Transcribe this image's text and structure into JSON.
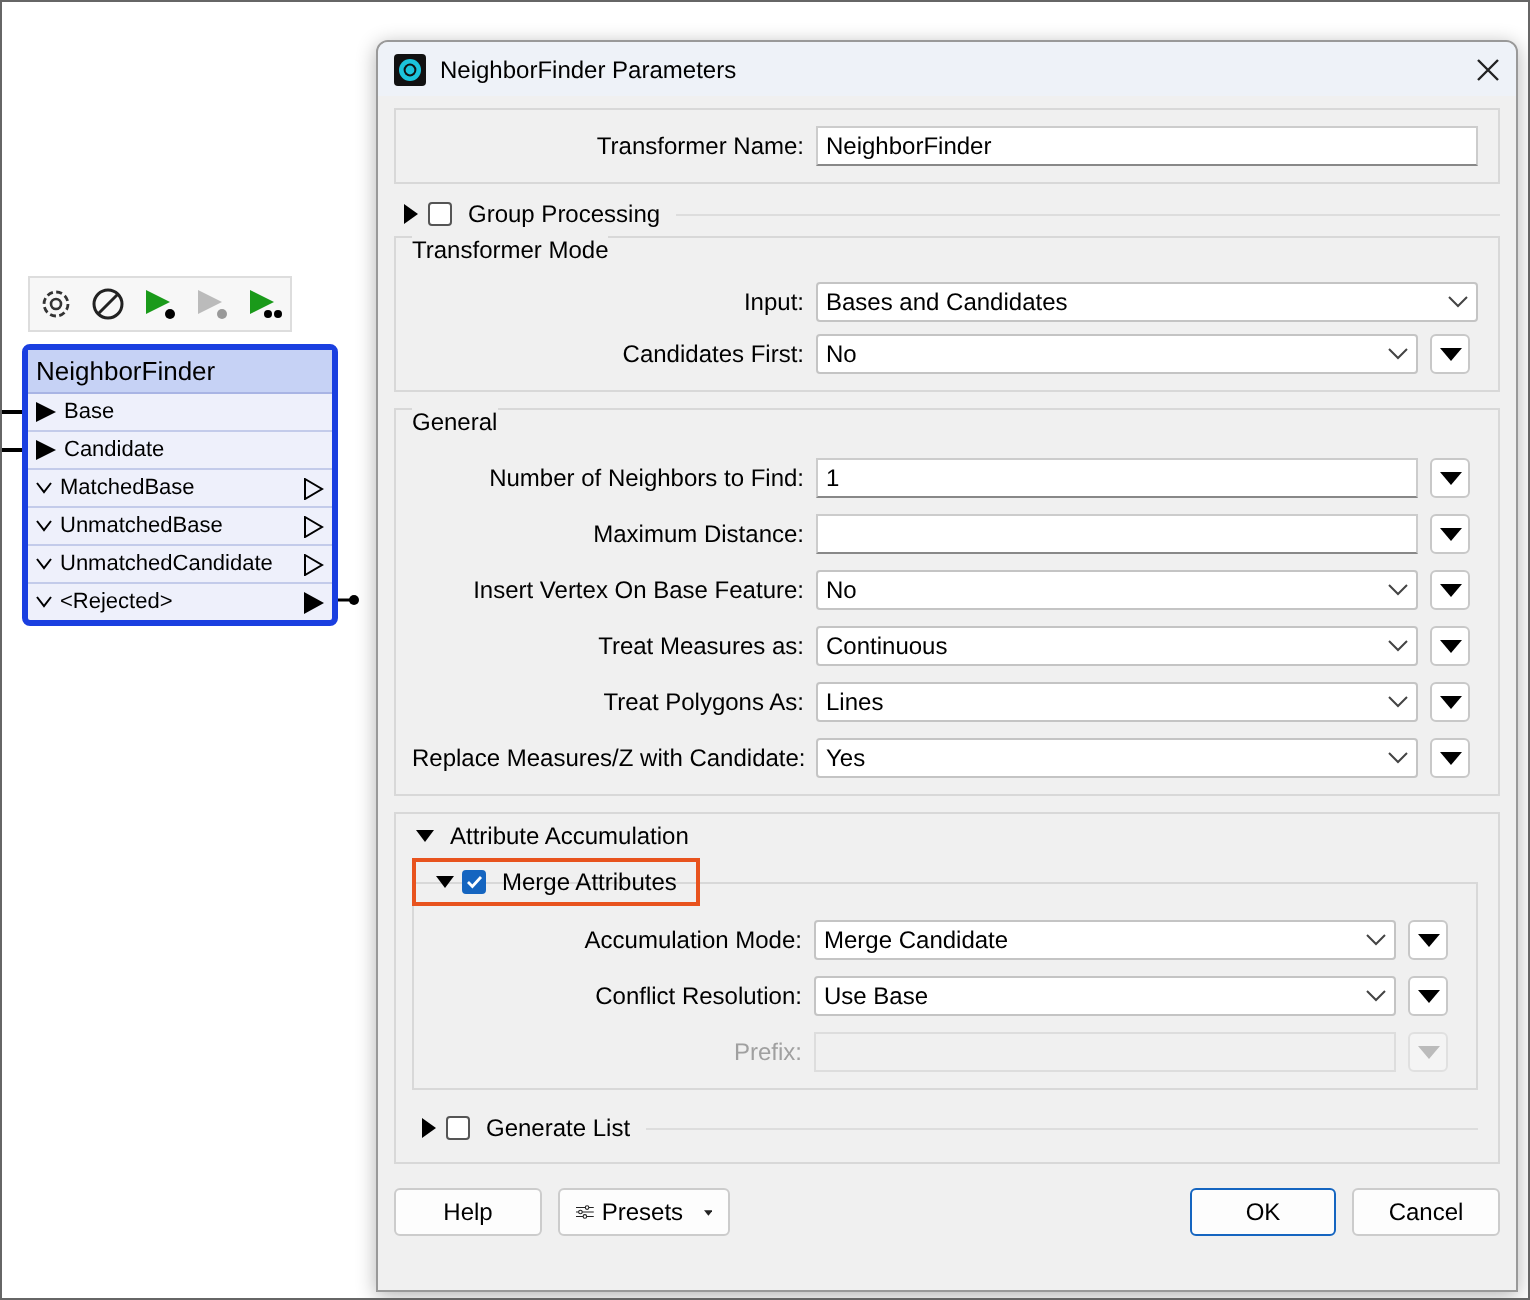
{
  "canvas": {
    "toolbar": [
      {
        "kind": "settings"
      },
      {
        "kind": "disable"
      },
      {
        "kind": "run",
        "disabled": false
      },
      {
        "kind": "run",
        "disabled": true
      },
      {
        "kind": "run-to",
        "disabled": false
      }
    ],
    "node": {
      "title": "NeighborFinder",
      "inputs": [
        {
          "label": "Base",
          "connected": true
        },
        {
          "label": "Candidate",
          "connected": true
        }
      ],
      "outputs": [
        {
          "label": "MatchedBase",
          "connected": false
        },
        {
          "label": "UnmatchedBase",
          "connected": false
        },
        {
          "label": "UnmatchedCandidate",
          "connected": false
        },
        {
          "label": "<Rejected>",
          "connected": true
        }
      ]
    }
  },
  "dialog": {
    "title": "NeighborFinder Parameters",
    "name_row": {
      "label": "Transformer Name:",
      "value": "NeighborFinder"
    },
    "group_processing": {
      "label": "Group Processing",
      "expanded": false,
      "checked": false
    },
    "transformer_mode": {
      "title": "Transformer Mode",
      "rows": [
        {
          "kind": "dropdown",
          "label": "Input:",
          "value": "Bases and Candidates",
          "menu": false,
          "disabled": false
        },
        {
          "kind": "dropdown",
          "label": "Candidates First:",
          "value": "No",
          "menu": true,
          "disabled": false
        }
      ]
    },
    "general": {
      "title": "General",
      "rows": [
        {
          "kind": "text",
          "label": "Number of Neighbors to Find:",
          "value": "1",
          "menu": true,
          "disabled": false
        },
        {
          "kind": "text",
          "label": "Maximum Distance:",
          "menu": true,
          "disabled": false
        },
        {
          "kind": "dropdown",
          "label": "Insert Vertex On Base Feature:",
          "value": "No",
          "menu": true,
          "disabled": false
        },
        {
          "kind": "dropdown",
          "label": "Treat Measures as:",
          "value": "Continuous",
          "menu": true,
          "disabled": false
        },
        {
          "kind": "dropdown",
          "label": "Treat Polygons As:",
          "value": "Lines",
          "menu": true,
          "disabled": false
        },
        {
          "kind": "dropdown",
          "label": "Replace Measures/Z with Candidate:",
          "value": "Yes",
          "menu": true,
          "disabled": false
        }
      ]
    },
    "attribute_accumulation": {
      "title": "Attribute Accumulation",
      "expanded": true,
      "merge": {
        "label": "Merge Attributes",
        "expanded": true,
        "checked": true,
        "highlighted": true,
        "rows": [
          {
            "kind": "dropdown",
            "label": "Accumulation Mode:",
            "value": "Merge Candidate",
            "menu": true,
            "disabled": false
          },
          {
            "kind": "dropdown",
            "label": "Conflict Resolution:",
            "value": "Use Base",
            "menu": true,
            "disabled": false
          },
          {
            "kind": "text",
            "label": "Prefix:",
            "menu": true,
            "disabled": true
          }
        ]
      },
      "generate_list": {
        "label": "Generate List",
        "expanded": false,
        "checked": false
      }
    },
    "buttons": [
      {
        "label": "Help",
        "kind": "plain",
        "default": false
      },
      {
        "label": "Presets",
        "kind": "presets",
        "default": false
      },
      {
        "label": "OK",
        "kind": "plain",
        "default": true
      },
      {
        "label": "Cancel",
        "kind": "plain",
        "default": false
      }
    ]
  }
}
